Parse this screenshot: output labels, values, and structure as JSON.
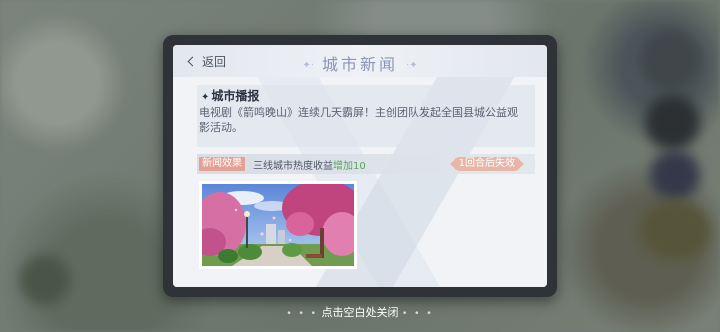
{
  "header": {
    "back_label": "返回",
    "title": "城市新闻"
  },
  "news": {
    "heading": "城市播报",
    "body": "电视剧《箭鸣晚山》连续几天霸屏！主创团队发起全国县城公益观影活动。"
  },
  "effect": {
    "tag": "新闻效果",
    "text": "三线城市热度收益",
    "increase": "增加10",
    "expire": "1回合后失效"
  },
  "footer": {
    "hint": "点击空白处关闭"
  },
  "colors": {
    "title": "#8a96b6",
    "tag": "#e2a394",
    "increase": "#58a45c"
  }
}
